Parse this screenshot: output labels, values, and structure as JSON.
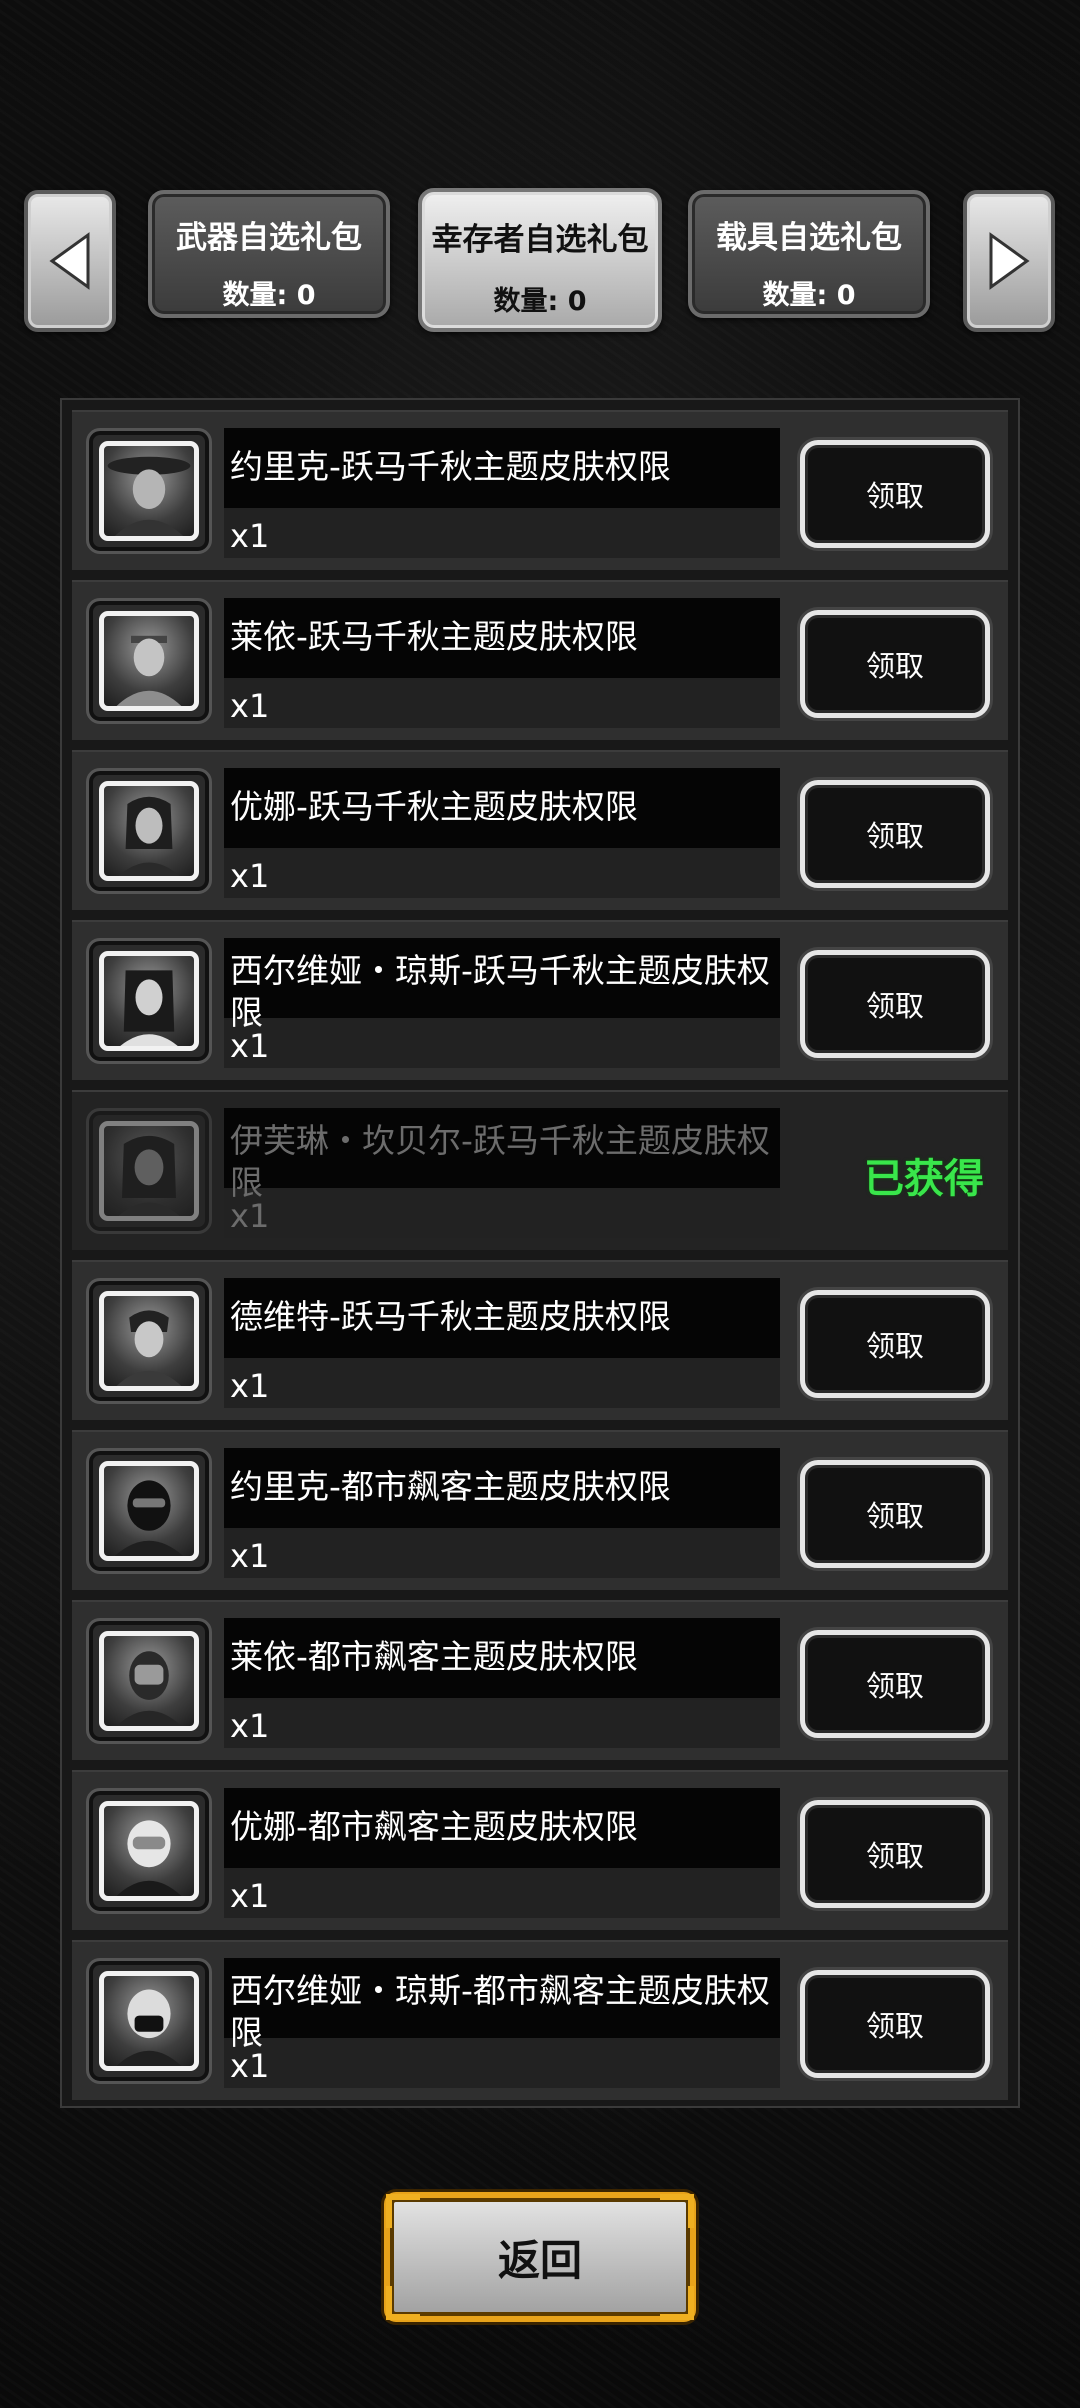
{
  "tabs": [
    {
      "name": "武器自选礼包",
      "count": "数量: 0"
    },
    {
      "name": "幸存者自选礼包",
      "count": "数量: 0"
    },
    {
      "name": "载具自选礼包",
      "count": "数量: 0"
    }
  ],
  "claim_label": "领取",
  "owned_label": "已获得",
  "items": [
    {
      "name": "约里克-跃马千秋主题皮肤权限",
      "qty": "x1"
    },
    {
      "name": "莱依-跃马千秋主题皮肤权限",
      "qty": "x1"
    },
    {
      "name": "优娜-跃马千秋主题皮肤权限",
      "qty": "x1"
    },
    {
      "name": "西尔维娅・琼斯-跃马千秋主题皮肤权限",
      "qty": "x1"
    },
    {
      "name": "伊芙琳・坎贝尔-跃马千秋主题皮肤权限",
      "qty": "x1"
    },
    {
      "name": "德维特-跃马千秋主题皮肤权限",
      "qty": "x1"
    },
    {
      "name": "约里克-都市飙客主题皮肤权限",
      "qty": "x1"
    },
    {
      "name": "莱依-都市飙客主题皮肤权限",
      "qty": "x1"
    },
    {
      "name": "优娜-都市飙客主题皮肤权限",
      "qty": "x1"
    },
    {
      "name": "西尔维娅・琼斯-都市飙客主题皮肤权限",
      "qty": "x1"
    }
  ],
  "back_label": "返回",
  "colors": {
    "owned": "#39e64b",
    "back_border": "#e8a31a"
  }
}
